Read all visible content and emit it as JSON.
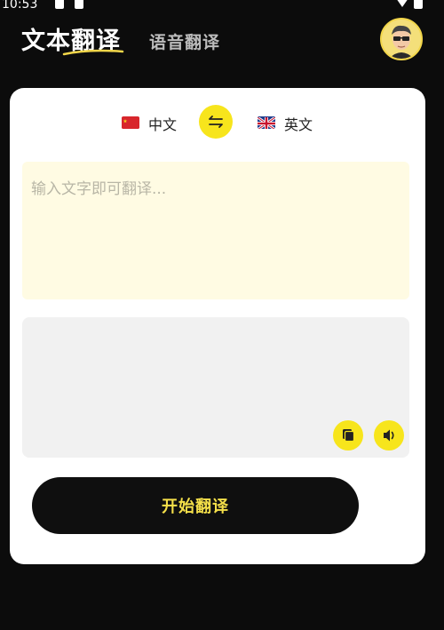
{
  "status_bar": {
    "time": "10:53"
  },
  "header": {
    "active_tab": "文本翻译",
    "inactive_tab": "语音翻译"
  },
  "languages": {
    "source": "中文",
    "target": "英文"
  },
  "input": {
    "placeholder": "输入文字即可翻译..."
  },
  "actions": {
    "translate_label": "开始翻译"
  },
  "colors": {
    "accent_yellow": "#f7e51c",
    "background": "#0c0c0c",
    "input_bg": "#fffbe3",
    "output_bg": "#f1f1f1"
  },
  "icons": {
    "swap": "swap-arrows-icon",
    "copy": "copy-icon",
    "speaker": "speaker-icon",
    "flag_source": "china-flag-icon",
    "flag_target": "uk-flag-icon"
  }
}
